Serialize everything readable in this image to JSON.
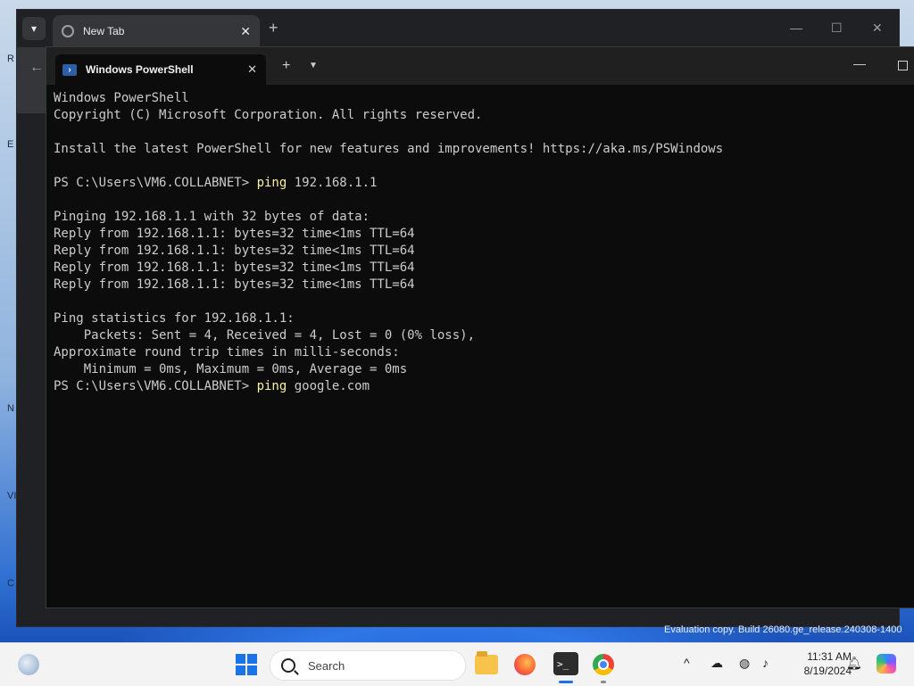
{
  "desktop": {
    "edge_labels": [
      "R",
      "E",
      "N",
      "VI",
      "C"
    ],
    "watermark": "Evaluation copy. Build 26080.ge_release.240308-1400"
  },
  "browser": {
    "tab_title": "New Tab",
    "tab_close": "✕",
    "new_tab": "+",
    "minimize": "—",
    "maximize": "☐",
    "close": "✕",
    "back": "←"
  },
  "terminal": {
    "tab_title": "Windows PowerShell",
    "tab_close": "✕",
    "add_tab": "+",
    "dropdown": "⌄",
    "minimize": "—",
    "lines": [
      {
        "text": "Windows PowerShell"
      },
      {
        "text": "Copyright (C) Microsoft Corporation. All rights reserved."
      },
      {
        "text": ""
      },
      {
        "text": "Install the latest PowerShell for new features and improvements! https://aka.ms/PSWindows"
      },
      {
        "text": ""
      },
      {
        "prompt": "PS C:\\Users\\VM6.COLLABNET> ",
        "cmd": "ping",
        "args": " 192.168.1.1"
      },
      {
        "text": ""
      },
      {
        "text": "Pinging 192.168.1.1 with 32 bytes of data:"
      },
      {
        "text": "Reply from 192.168.1.1: bytes=32 time<1ms TTL=64"
      },
      {
        "text": "Reply from 192.168.1.1: bytes=32 time<1ms TTL=64"
      },
      {
        "text": "Reply from 192.168.1.1: bytes=32 time<1ms TTL=64"
      },
      {
        "text": "Reply from 192.168.1.1: bytes=32 time<1ms TTL=64"
      },
      {
        "text": ""
      },
      {
        "text": "Ping statistics for 192.168.1.1:"
      },
      {
        "text": "    Packets: Sent = 4, Received = 4, Lost = 0 (0% loss),"
      },
      {
        "text": "Approximate round trip times in milli-seconds:"
      },
      {
        "text": "    Minimum = 0ms, Maximum = 0ms, Average = 0ms"
      },
      {
        "prompt": "PS C:\\Users\\VM6.COLLABNET> ",
        "cmd": "ping",
        "args": " google.com"
      }
    ],
    "command_color": "#f9f1a5"
  },
  "taskbar": {
    "search_placeholder": "Search",
    "terminal_icon_glyph": ">_",
    "tray_chevron": "^",
    "time": "11:31 AM",
    "date": "8/19/2024",
    "accent": "#1a73e8"
  }
}
